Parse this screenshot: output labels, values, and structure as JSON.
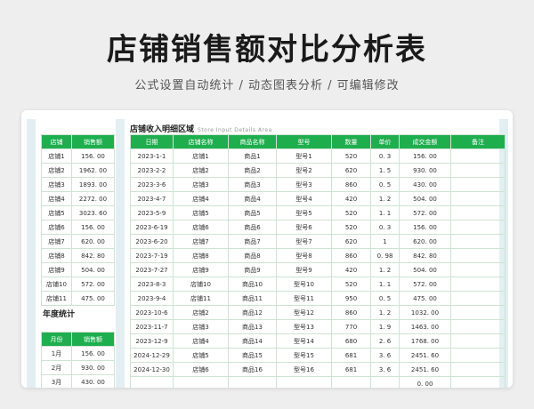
{
  "header": {
    "title": "店铺销售额对比分析表",
    "subtitle": "公式设置自动统计 / 动态图表分析 / 可编辑修改"
  },
  "left_stores": {
    "headers": [
      "店铺",
      "销售额"
    ],
    "rows": [
      [
        "店铺1",
        "156. 00"
      ],
      [
        "店铺2",
        "1962. 00"
      ],
      [
        "店铺3",
        "1893. 00"
      ],
      [
        "店铺4",
        "2272. 00"
      ],
      [
        "店铺5",
        "3023. 60"
      ],
      [
        "店铺6",
        "156. 00"
      ],
      [
        "店铺7",
        "620. 00"
      ],
      [
        "店铺8",
        "842. 80"
      ],
      [
        "店铺9",
        "504. 00"
      ],
      [
        "店铺10",
        "572. 00"
      ],
      [
        "店铺11",
        "475. 00"
      ]
    ]
  },
  "annual": {
    "label": "年度统计",
    "headers": [
      "月份",
      "销售额"
    ],
    "rows": [
      [
        "1月",
        "156. 00"
      ],
      [
        "2月",
        "930. 00"
      ],
      [
        "3月",
        "430. 00"
      ]
    ]
  },
  "detail": {
    "title": "店铺收入明细区域",
    "title_en": "Store Input Details Area",
    "headers": [
      "日期",
      "店铺名称",
      "商品名称",
      "型号",
      "数量",
      "单价",
      "成交金额",
      "备注"
    ],
    "rows": [
      [
        "2023-1-1",
        "店铺1",
        "商品1",
        "型号1",
        "520",
        "0. 3",
        "156. 00",
        ""
      ],
      [
        "2023-2-2",
        "店铺2",
        "商品2",
        "型号2",
        "620",
        "1. 5",
        "930. 00",
        ""
      ],
      [
        "2023-3-6",
        "店铺3",
        "商品3",
        "型号3",
        "860",
        "0. 5",
        "430. 00",
        ""
      ],
      [
        "2023-4-7",
        "店铺4",
        "商品4",
        "型号4",
        "420",
        "1. 2",
        "504. 00",
        ""
      ],
      [
        "2023-5-9",
        "店铺5",
        "商品5",
        "型号5",
        "520",
        "1. 1",
        "572. 00",
        ""
      ],
      [
        "2023-6-19",
        "店铺6",
        "商品6",
        "型号6",
        "520",
        "0. 3",
        "156. 00",
        ""
      ],
      [
        "2023-6-20",
        "店铺7",
        "商品7",
        "型号7",
        "620",
        "1",
        "620. 00",
        ""
      ],
      [
        "2023-7-19",
        "店铺8",
        "商品8",
        "型号8",
        "860",
        "0. 98",
        "842. 80",
        ""
      ],
      [
        "2023-7-27",
        "店铺9",
        "商品9",
        "型号9",
        "420",
        "1. 2",
        "504. 00",
        ""
      ],
      [
        "2023-8-3",
        "店铺10",
        "商品10",
        "型号10",
        "520",
        "1. 1",
        "572. 00",
        ""
      ],
      [
        "2023-9-4",
        "店铺11",
        "商品11",
        "型号11",
        "950",
        "0. 5",
        "475. 00",
        ""
      ],
      [
        "2023-10-6",
        "店铺2",
        "商品12",
        "型号12",
        "860",
        "1. 2",
        "1032. 00",
        ""
      ],
      [
        "2023-11-7",
        "店铺3",
        "商品13",
        "型号13",
        "770",
        "1. 9",
        "1463. 00",
        ""
      ],
      [
        "2023-12-9",
        "店铺4",
        "商品14",
        "型号14",
        "680",
        "2. 6",
        "1768. 00",
        ""
      ],
      [
        "2024-12-29",
        "店铺5",
        "商品15",
        "型号15",
        "681",
        "3. 6",
        "2451. 60",
        ""
      ],
      [
        "2024-12-30",
        "店铺6",
        "商品16",
        "型号16",
        "681",
        "3. 6",
        "2451. 60",
        ""
      ],
      [
        "",
        "",
        "",
        "",
        "",
        "",
        "0. 00",
        ""
      ]
    ]
  }
}
